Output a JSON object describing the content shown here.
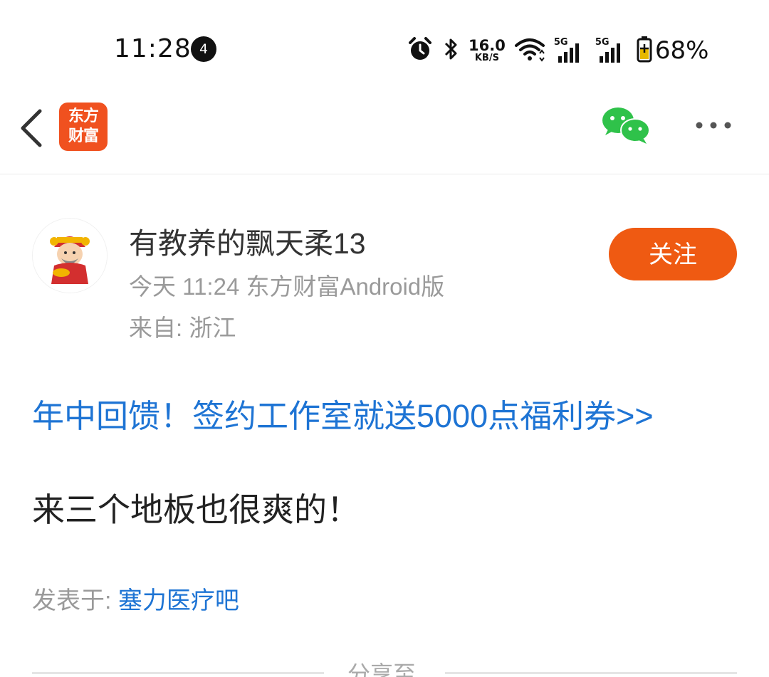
{
  "status_bar": {
    "time": "11:28",
    "notification_count": "4",
    "speed_value": "16.0",
    "speed_unit": "KB/S",
    "sim1_label": "5G",
    "sim2_label": "5G",
    "battery": "68%"
  },
  "nav": {
    "logo_line1": "东方",
    "logo_line2": "财富",
    "brand_color": "#f0511f"
  },
  "author": {
    "name": "有教养的飘天柔13",
    "meta": "今天 11:24 东方财富Android版",
    "location": "来自: 浙江",
    "follow_label": "关注"
  },
  "content": {
    "promo": "年中回馈！签约工作室就送5000点福利券>>",
    "post_text": "来三个地板也很爽的！",
    "posted_label": "发表于: ",
    "posted_bar": "塞力医疗吧"
  },
  "share": {
    "label": "分享至"
  },
  "colors": {
    "accent_blue": "#1e74d4",
    "follow_orange": "#ef5a12",
    "wechat_green": "#2fc24a"
  }
}
